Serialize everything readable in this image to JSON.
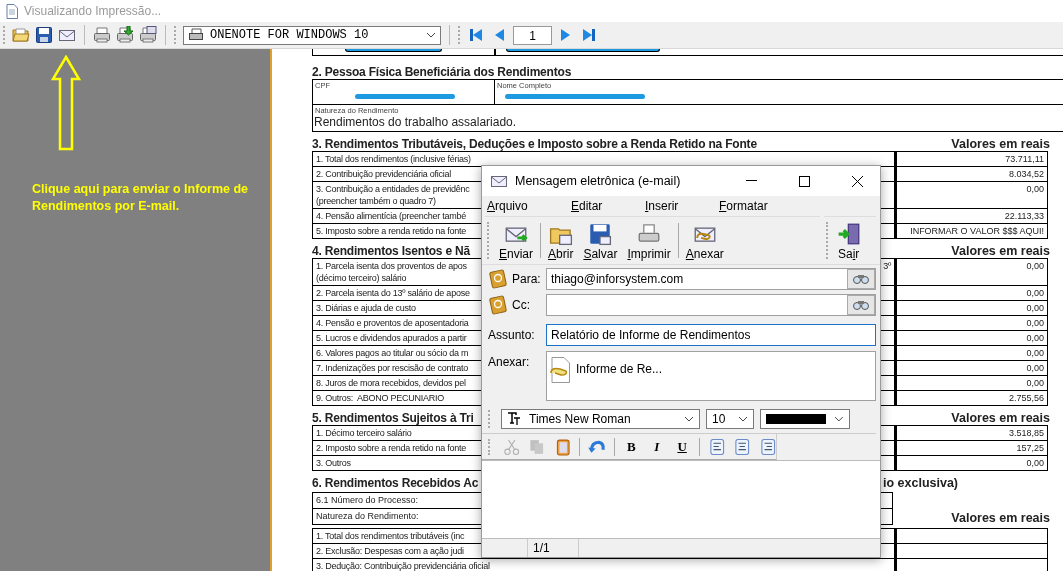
{
  "window": {
    "title": "Visualizando Impressão..."
  },
  "toolbar": {
    "printer": "ONENOTE FOR WINDOWS 10",
    "page": "1"
  },
  "callout": {
    "text": "Clique aqui para enviar o Informe de Rendimentos por E-mail."
  },
  "document": {
    "sections": [
      {
        "kind": "person",
        "title": "2. Pessoa Física Beneficiária dos Rendimentos",
        "cpf_label": "CPF",
        "name_label": "Nome Completo",
        "nature_label": "Natureza do Rendimento",
        "nature": "Rendimentos do trabalho assalariado."
      },
      {
        "kind": "values",
        "title": "3. Rendimentos Tributáveis, Deduções e Imposto sobre a Renda Retido na Fonte",
        "values_header": "Valores em reais",
        "rows": [
          {
            "label": "1. Total dos rendimentos (inclusive férias)",
            "value": "73.711,11"
          },
          {
            "label": "2. Contribuição previdenciária oficial",
            "value": "8.034,52"
          },
          {
            "label": "3. Contribuição a entidades de previdênc\n(preencher também o quadro 7)",
            "value": "0,00"
          },
          {
            "label": "4. Pensão alimentícia (preencher també",
            "value": "22.113,33"
          },
          {
            "label": "5. Imposto sobre a renda retido na fonte",
            "value": "INFORMAR O VALOR $$$ AQUI!"
          }
        ]
      },
      {
        "kind": "values",
        "title": "4. Rendimentos Isentos e Nã",
        "values_header": "Valores em reais",
        "rows": [
          {
            "label": "1. Parcela isenta dos proventos de apos\n(décimo terceiro) salário",
            "tail": "3º",
            "value": "0,00"
          },
          {
            "label": "2. Parcela isenta do 13º salário de apose",
            "value": "0,00"
          },
          {
            "label": "3. Diárias e ajuda de custo",
            "value": "0,00"
          },
          {
            "label": "4. Pensão e proventos de aposentadoria",
            "value": "0,00"
          },
          {
            "label": "5. Lucros e dividendos apurados a partir",
            "value": "0,00"
          },
          {
            "label": "6. Valores pagos ao titular ou sócio da m",
            "value": "0,00"
          },
          {
            "label": "7. Indenizações por rescisão de contrato",
            "value": "0,00"
          },
          {
            "label": "8. Juros de mora recebidos, devidos pel",
            "value": "0,00"
          },
          {
            "label": "9. Outros:  ABONO PECUNIARIO",
            "value": "2.755,56"
          }
        ]
      },
      {
        "kind": "values",
        "title": "5. Rendimentos Sujeitos à Tri",
        "values_header": "Valores em reais",
        "rows": [
          {
            "label": "1. Décimo terceiro salário",
            "value": "3.518,85"
          },
          {
            "label": "2. Imposto sobre a renda retido na fonte",
            "value": "157,25"
          },
          {
            "label": "3. Outros",
            "value": "0,00"
          }
        ]
      },
      {
        "kind": "lawsuit",
        "title": "6. Rendimentos Recebidos Ac",
        "title_tail": "io exclusiva)",
        "info": [
          "6.1 Número do Processo:",
          "Natureza do Rendimento:"
        ],
        "values_header": "Valores em reais",
        "rows": [
          {
            "label": "1. Total dos rendimentos tributáveis (inc"
          },
          {
            "label": "2. Exclusão: Despesas com a ação judi"
          },
          {
            "label": "3. Dedução: Contribuição previdenciária oficial"
          }
        ]
      }
    ]
  },
  "mail_dialog": {
    "title": "Mensagem eletrônica (e-mail)",
    "menu": [
      {
        "key": "A",
        "post": "rquivo"
      },
      {
        "key": "E",
        "post": "ditar"
      },
      {
        "key": "I",
        "post": "nserir"
      },
      {
        "key": "F",
        "post": "ormatar"
      }
    ],
    "tool_groups": [
      [
        {
          "kind": "send",
          "key": "E",
          "post": "nviar"
        }
      ],
      [
        {
          "kind": "open",
          "key": "A",
          "post": "brir"
        },
        {
          "kind": "save",
          "key": "S",
          "post": "alvar"
        },
        {
          "kind": "print",
          "key": "I",
          "post": "mprimir"
        }
      ],
      [
        {
          "kind": "attach",
          "key": "A",
          "post": "nexar"
        }
      ]
    ],
    "exit_tool": {
      "kind": "exit",
      "pre": "Sa",
      "key": "i",
      "post": "r"
    },
    "to_label": "Para:",
    "to": "thiago@inforsystem.com",
    "cc_label": "Cc:",
    "subject_label": "Assunto:",
    "subject": "Relatório de Informe de Rendimentos",
    "attach_label": "Anexar:",
    "attachment": "Informe de Re...",
    "font": "Times New Roman",
    "size": "10",
    "format_groups": [
      [
        {
          "kind": "cut",
          "disabled": true
        },
        {
          "kind": "copy",
          "disabled": true
        },
        {
          "kind": "paste",
          "disabled": false
        }
      ],
      [
        {
          "kind": "undo",
          "disabled": false
        }
      ],
      [
        {
          "kind": "bold",
          "text": "B"
        },
        {
          "kind": "italic",
          "text": "I"
        },
        {
          "kind": "underline",
          "text": "U"
        }
      ],
      [
        {
          "kind": "align-left"
        },
        {
          "kind": "align-center"
        },
        {
          "kind": "align-right"
        }
      ]
    ],
    "status": "1/1"
  }
}
